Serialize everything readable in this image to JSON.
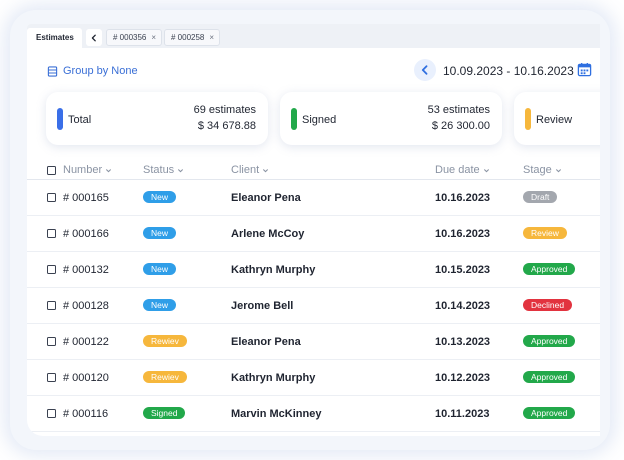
{
  "tabs": {
    "main": "Estimates",
    "sub": [
      {
        "label": "# 000356",
        "close": "×"
      },
      {
        "label": "# 000258",
        "close": "×"
      }
    ]
  },
  "toolbar": {
    "group_by": "Group by None",
    "date_range": "10.09.2023 - 10.16.2023",
    "icons": [
      "list-icon",
      "chevron-left-icon",
      "calendar-icon"
    ]
  },
  "summary": [
    {
      "label": "Total",
      "count": "69 estimates",
      "amount": "$ 34 678.88",
      "color": "#3a6fe8"
    },
    {
      "label": "Signed",
      "count": "53 estimates",
      "amount": "$ 26 300.00",
      "color": "#22a84a"
    },
    {
      "label": "Review",
      "count": "",
      "amount": "",
      "color": "#f6b73c"
    }
  ],
  "columns": {
    "number": "Number",
    "status": "Status",
    "client": "Client",
    "due": "Due date",
    "stage": "Stage"
  },
  "colors": {
    "New": "#2f9ee8",
    "Rewiev": "#f6b73c",
    "Signed": "#22a84a",
    "Draft": "#a3a7ae",
    "Review": "#f6b73c",
    "Approved": "#22a84a",
    "Declined": "#e2333f",
    "accent": "#3a6fd6"
  },
  "rows": [
    {
      "number": "# 000165",
      "status": "New",
      "client": "Eleanor Pena",
      "due": "10.16.2023",
      "stage": "Draft"
    },
    {
      "number": "# 000166",
      "status": "New",
      "client": "Arlene McCoy",
      "due": "10.16.2023",
      "stage": "Review"
    },
    {
      "number": "# 000132",
      "status": "New",
      "client": "Kathryn Murphy",
      "due": "10.15.2023",
      "stage": "Approved"
    },
    {
      "number": "# 000128",
      "status": "New",
      "client": "Jerome Bell",
      "due": "10.14.2023",
      "stage": "Declined"
    },
    {
      "number": "# 000122",
      "status": "Rewiev",
      "client": "Eleanor Pena",
      "due": "10.13.2023",
      "stage": "Approved"
    },
    {
      "number": "# 000120",
      "status": "Rewiev",
      "client": "Kathryn Murphy",
      "due": "10.12.2023",
      "stage": "Approved"
    },
    {
      "number": "# 000116",
      "status": "Signed",
      "client": "Marvin McKinney",
      "due": "10.11.2023",
      "stage": "Approved"
    }
  ]
}
